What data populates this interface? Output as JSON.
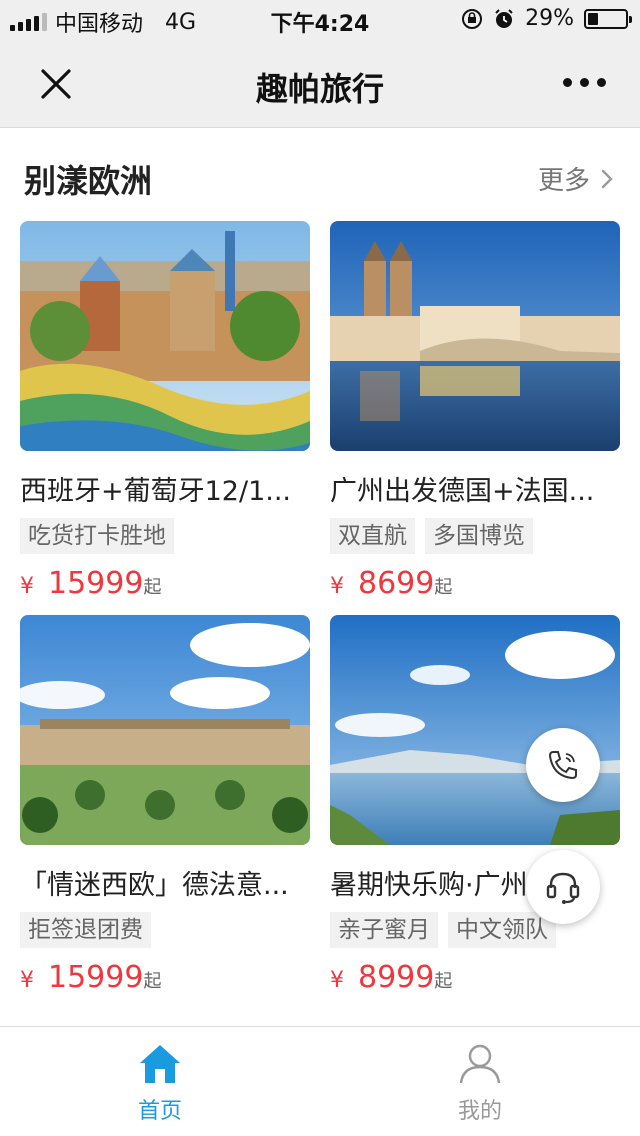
{
  "status_bar": {
    "carrier": "中国移动",
    "network": "4G",
    "time": "下午4:24",
    "battery": "29%",
    "battery_level": 0.29
  },
  "nav": {
    "title": "趣帕旅行",
    "close_icon": "close-icon",
    "more_icon": "more-dots-icon"
  },
  "section": {
    "title": "别漾欧洲",
    "more_label": "更多"
  },
  "products": [
    {
      "title": "西班牙+葡萄牙12/1...",
      "tags": [
        "吃货打卡胜地"
      ],
      "currency": "¥",
      "price": "15999",
      "price_suffix": "起",
      "image": "park-guell-barcelona"
    },
    {
      "title": "广州出发德国+法国...",
      "tags": [
        "双直航",
        "多国博览"
      ],
      "currency": "¥",
      "price": "8699",
      "price_suffix": "起",
      "image": "zurich-river-night"
    },
    {
      "title": "「情迷西欧」德法意...",
      "tags": [
        "拒签退团费"
      ],
      "currency": "¥",
      "price": "15999",
      "price_suffix": "起",
      "image": "versailles-palace-garden"
    },
    {
      "title": "暑期快乐购·广州直...",
      "tags": [
        "亲子蜜月",
        "中文领队"
      ],
      "currency": "¥",
      "price": "8999",
      "price_suffix": "起",
      "image": "lake-blue-sky"
    }
  ],
  "floating": {
    "phone_icon": "phone-icon",
    "support_icon": "headset-icon"
  },
  "tab_bar": {
    "home_label": "首页",
    "mine_label": "我的",
    "active_color": "#1a9be0",
    "inactive_color": "#999999"
  },
  "colors": {
    "price": "#f0373d",
    "header_bg": "#efefef"
  }
}
